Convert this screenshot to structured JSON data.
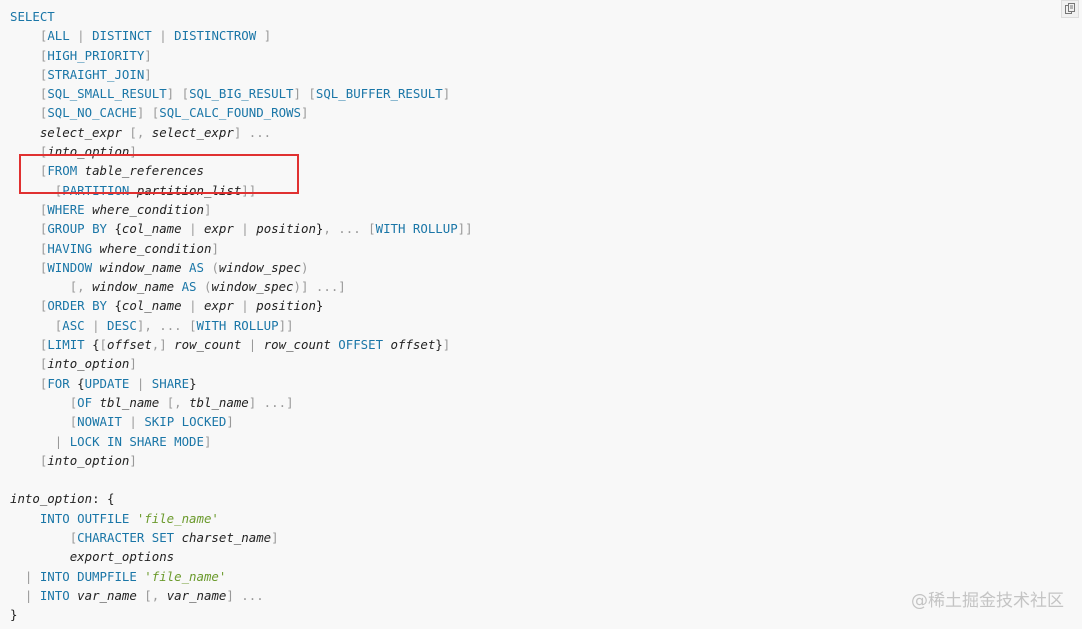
{
  "colors": {
    "keyword": "#1a76a7",
    "punctuation": "#999999",
    "variable": "#222222",
    "string": "#6b9a2c",
    "highlight": "#e03131",
    "background": "#f8f8f8"
  },
  "copy_button": {
    "icon": "copy-icon"
  },
  "watermark": "@稀土掘金技术社区",
  "code_lines": [
    [
      [
        "kw",
        "SELECT"
      ]
    ],
    [
      [
        "t",
        "    "
      ],
      [
        "p",
        "["
      ],
      [
        "kw",
        "ALL"
      ],
      [
        "p",
        " | "
      ],
      [
        "kw",
        "DISTINCT"
      ],
      [
        "p",
        " | "
      ],
      [
        "kw",
        "DISTINCTROW"
      ],
      [
        "p",
        " ]"
      ]
    ],
    [
      [
        "t",
        "    "
      ],
      [
        "p",
        "["
      ],
      [
        "kw",
        "HIGH_PRIORITY"
      ],
      [
        "p",
        "]"
      ]
    ],
    [
      [
        "t",
        "    "
      ],
      [
        "p",
        "["
      ],
      [
        "kw",
        "STRAIGHT_JOIN"
      ],
      [
        "p",
        "]"
      ]
    ],
    [
      [
        "t",
        "    "
      ],
      [
        "p",
        "["
      ],
      [
        "kw",
        "SQL_SMALL_RESULT"
      ],
      [
        "p",
        "] ["
      ],
      [
        "kw",
        "SQL_BIG_RESULT"
      ],
      [
        "p",
        "] ["
      ],
      [
        "kw",
        "SQL_BUFFER_RESULT"
      ],
      [
        "p",
        "]"
      ]
    ],
    [
      [
        "t",
        "    "
      ],
      [
        "p",
        "["
      ],
      [
        "kw",
        "SQL_NO_CACHE"
      ],
      [
        "p",
        "] ["
      ],
      [
        "kw",
        "SQL_CALC_FOUND_ROWS"
      ],
      [
        "p",
        "]"
      ]
    ],
    [
      [
        "t",
        "    "
      ],
      [
        "v",
        "select_expr"
      ],
      [
        "p",
        " [, "
      ],
      [
        "v",
        "select_expr"
      ],
      [
        "p",
        "] ..."
      ]
    ],
    [
      [
        "t",
        "    "
      ],
      [
        "p",
        "["
      ],
      [
        "v",
        "into_option"
      ],
      [
        "p",
        "]"
      ]
    ],
    [
      [
        "t",
        "    "
      ],
      [
        "p",
        "["
      ],
      [
        "kw",
        "FROM "
      ],
      [
        "v",
        "table_references"
      ]
    ],
    [
      [
        "t",
        "      "
      ],
      [
        "p",
        "["
      ],
      [
        "kw",
        "PARTITION "
      ],
      [
        "v",
        "partition_list"
      ],
      [
        "p",
        "]]"
      ]
    ],
    [
      [
        "t",
        "    "
      ],
      [
        "p",
        "["
      ],
      [
        "kw",
        "WHERE "
      ],
      [
        "v",
        "where_condition"
      ],
      [
        "p",
        "]"
      ]
    ],
    [
      [
        "t",
        "    "
      ],
      [
        "p",
        "["
      ],
      [
        "kw",
        "GROUP BY "
      ],
      [
        "t",
        "{"
      ],
      [
        "v",
        "col_name"
      ],
      [
        "p",
        " | "
      ],
      [
        "v",
        "expr"
      ],
      [
        "p",
        " | "
      ],
      [
        "v",
        "position"
      ],
      [
        "t",
        "}"
      ],
      [
        "p",
        ", ... ["
      ],
      [
        "kw",
        "WITH ROLLUP"
      ],
      [
        "p",
        "]]"
      ]
    ],
    [
      [
        "t",
        "    "
      ],
      [
        "p",
        "["
      ],
      [
        "kw",
        "HAVING "
      ],
      [
        "v",
        "where_condition"
      ],
      [
        "p",
        "]"
      ]
    ],
    [
      [
        "t",
        "    "
      ],
      [
        "p",
        "["
      ],
      [
        "kw",
        "WINDOW "
      ],
      [
        "v",
        "window_name"
      ],
      [
        "kw",
        " AS "
      ],
      [
        "p",
        "("
      ],
      [
        "v",
        "window_spec"
      ],
      [
        "p",
        ")"
      ]
    ],
    [
      [
        "t",
        "        "
      ],
      [
        "p",
        "[, "
      ],
      [
        "v",
        "window_name"
      ],
      [
        "kw",
        " AS "
      ],
      [
        "p",
        "("
      ],
      [
        "v",
        "window_spec"
      ],
      [
        "p",
        ")] ...]"
      ]
    ],
    [
      [
        "t",
        "    "
      ],
      [
        "p",
        "["
      ],
      [
        "kw",
        "ORDER BY "
      ],
      [
        "t",
        "{"
      ],
      [
        "v",
        "col_name"
      ],
      [
        "p",
        " | "
      ],
      [
        "v",
        "expr"
      ],
      [
        "p",
        " | "
      ],
      [
        "v",
        "position"
      ],
      [
        "t",
        "}"
      ]
    ],
    [
      [
        "t",
        "      "
      ],
      [
        "p",
        "["
      ],
      [
        "kw",
        "ASC"
      ],
      [
        "p",
        " | "
      ],
      [
        "kw",
        "DESC"
      ],
      [
        "p",
        "], ... ["
      ],
      [
        "kw",
        "WITH ROLLUP"
      ],
      [
        "p",
        "]]"
      ]
    ],
    [
      [
        "t",
        "    "
      ],
      [
        "p",
        "["
      ],
      [
        "kw",
        "LIMIT "
      ],
      [
        "t",
        "{"
      ],
      [
        "p",
        "["
      ],
      [
        "v",
        "offset"
      ],
      [
        "p",
        ",] "
      ],
      [
        "v",
        "row_count"
      ],
      [
        "p",
        " | "
      ],
      [
        "v",
        "row_count"
      ],
      [
        "kw",
        " OFFSET "
      ],
      [
        "v",
        "offset"
      ],
      [
        "t",
        "}"
      ],
      [
        "p",
        "]"
      ]
    ],
    [
      [
        "t",
        "    "
      ],
      [
        "p",
        "["
      ],
      [
        "v",
        "into_option"
      ],
      [
        "p",
        "]"
      ]
    ],
    [
      [
        "t",
        "    "
      ],
      [
        "p",
        "["
      ],
      [
        "kw",
        "FOR "
      ],
      [
        "t",
        "{"
      ],
      [
        "kw",
        "UPDATE"
      ],
      [
        "p",
        " | "
      ],
      [
        "kw",
        "SHARE"
      ],
      [
        "t",
        "}"
      ]
    ],
    [
      [
        "t",
        "        "
      ],
      [
        "p",
        "["
      ],
      [
        "kw",
        "OF "
      ],
      [
        "v",
        "tbl_name"
      ],
      [
        "p",
        " [, "
      ],
      [
        "v",
        "tbl_name"
      ],
      [
        "p",
        "] ...]"
      ]
    ],
    [
      [
        "t",
        "        "
      ],
      [
        "p",
        "["
      ],
      [
        "kw",
        "NOWAIT"
      ],
      [
        "p",
        " | "
      ],
      [
        "kw",
        "SKIP LOCKED"
      ],
      [
        "p",
        "]"
      ]
    ],
    [
      [
        "t",
        "      "
      ],
      [
        "p",
        "| "
      ],
      [
        "kw",
        "LOCK IN SHARE MODE"
      ],
      [
        "p",
        "]"
      ]
    ],
    [
      [
        "t",
        "    "
      ],
      [
        "p",
        "["
      ],
      [
        "v",
        "into_option"
      ],
      [
        "p",
        "]"
      ]
    ],
    [],
    [
      [
        "v",
        "into_option"
      ],
      [
        "t",
        ": {"
      ]
    ],
    [
      [
        "t",
        "    "
      ],
      [
        "kw",
        "INTO OUTFILE "
      ],
      [
        "s",
        "'file_name'"
      ]
    ],
    [
      [
        "t",
        "        "
      ],
      [
        "p",
        "["
      ],
      [
        "kw",
        "CHARACTER SET "
      ],
      [
        "v",
        "charset_name"
      ],
      [
        "p",
        "]"
      ]
    ],
    [
      [
        "t",
        "        "
      ],
      [
        "v",
        "export_options"
      ]
    ],
    [
      [
        "t",
        "  "
      ],
      [
        "p",
        "| "
      ],
      [
        "kw",
        "INTO DUMPFILE "
      ],
      [
        "s",
        "'file_name'"
      ]
    ],
    [
      [
        "t",
        "  "
      ],
      [
        "p",
        "| "
      ],
      [
        "kw",
        "INTO "
      ],
      [
        "v",
        "var_name"
      ],
      [
        "p",
        " [, "
      ],
      [
        "v",
        "var_name"
      ],
      [
        "p",
        "] ..."
      ]
    ],
    [
      [
        "t",
        "}"
      ]
    ]
  ]
}
